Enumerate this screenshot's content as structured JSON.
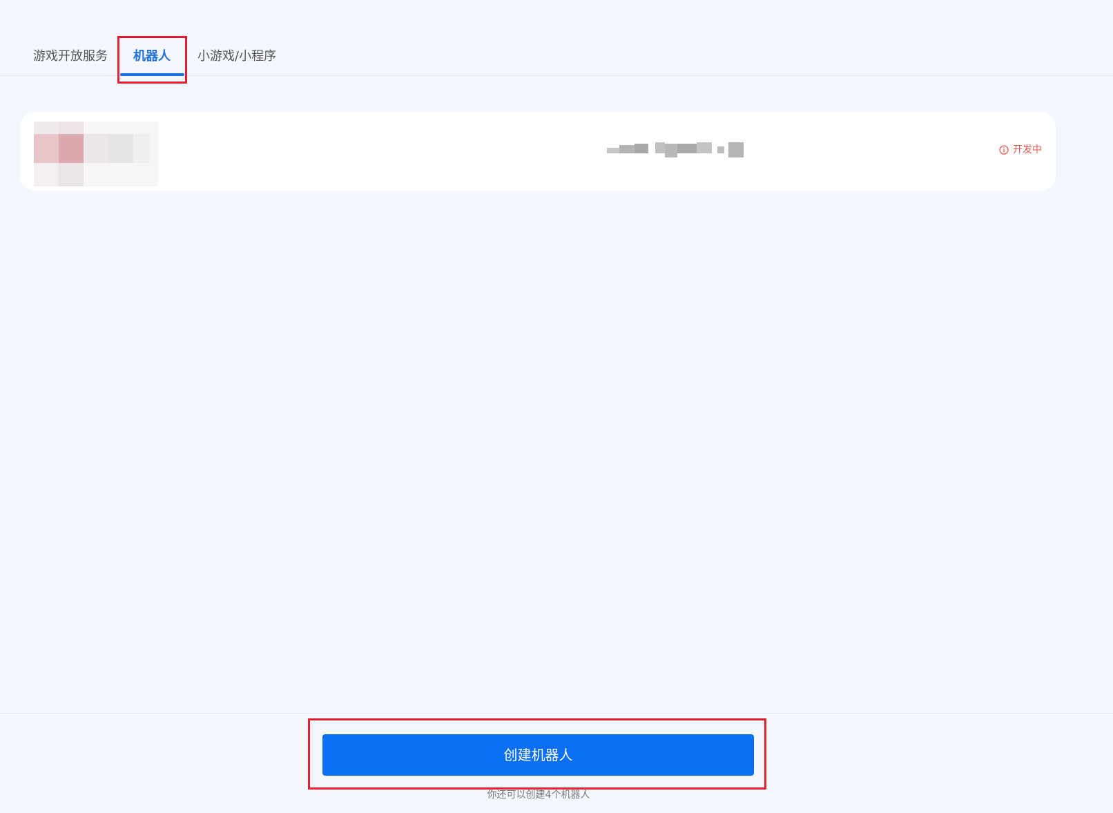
{
  "tabs": {
    "games_label": "游戏开放服务",
    "bot_label": "机器人",
    "mini_label": "小游戏/小程序",
    "active": "机器人"
  },
  "bot_card": {
    "status_label": "开发中",
    "status_icon": "info-icon",
    "status_color": "#e45a4f"
  },
  "footer": {
    "create_button_label": "创建机器人",
    "quota_text": "你还可以创建4个机器人"
  },
  "colors": {
    "accent": "#0a6ff0",
    "highlight": "#e5202e",
    "background": "#f4f7fd"
  }
}
